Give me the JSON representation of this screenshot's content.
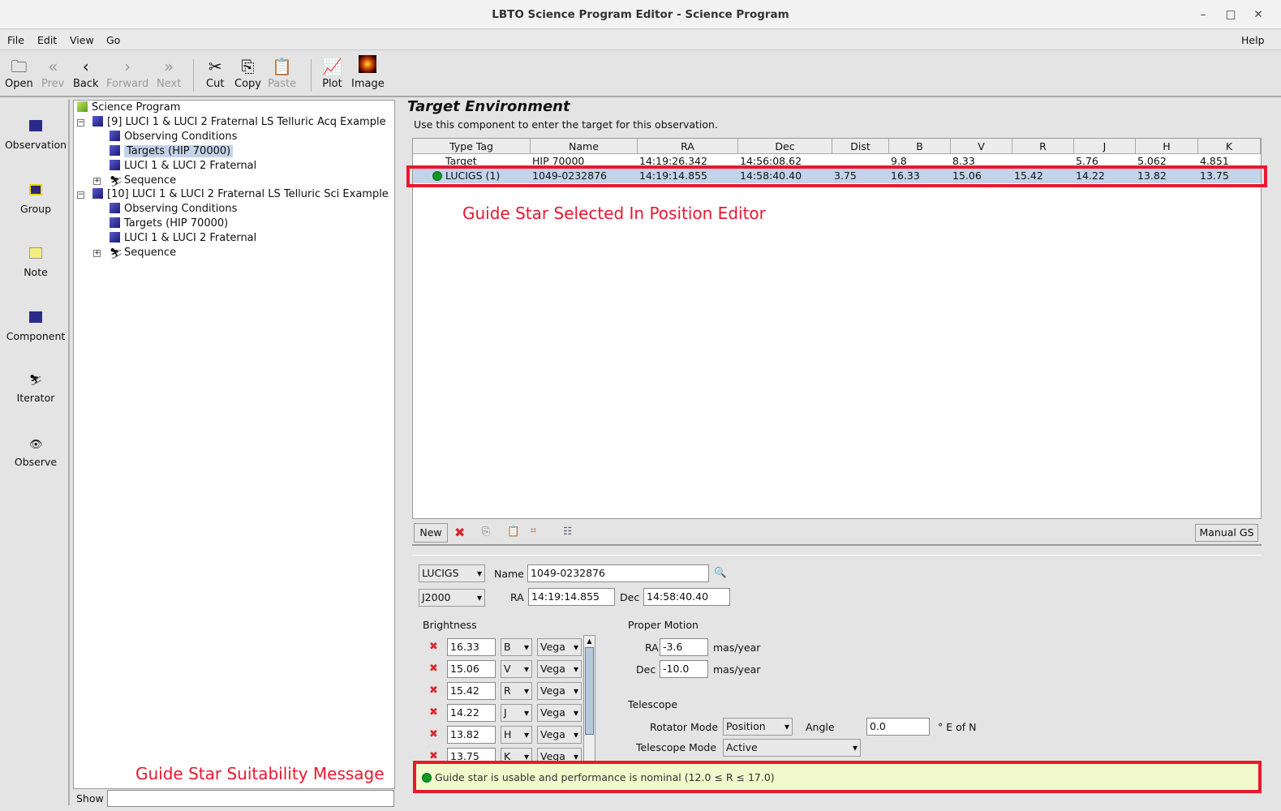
{
  "window": {
    "title": "LBTO Science Program Editor - Science Program",
    "minimize": "–",
    "maximize": "□",
    "close": "✕"
  },
  "menu": {
    "file": "File",
    "edit": "Edit",
    "view": "View",
    "go": "Go",
    "help": "Help"
  },
  "toolbar": {
    "open": "Open",
    "prev": "Prev",
    "back": "Back",
    "forward": "Forward",
    "next": "Next",
    "cut": "Cut",
    "copy": "Copy",
    "paste": "Paste",
    "plot": "Plot",
    "image": "Image"
  },
  "palette": {
    "observation": "Observation",
    "group": "Group",
    "note": "Note",
    "component": "Component",
    "iterator": "Iterator",
    "observe": "Observe"
  },
  "tree": {
    "root": "Science Program",
    "obs1": {
      "label": "[9] LUCI 1 & LUCI 2 Fraternal LS Telluric Acq Example",
      "children": [
        "Observing Conditions",
        "Targets (HIP 70000)",
        "LUCI 1 & LUCI 2 Fraternal",
        "Sequence"
      ]
    },
    "obs2": {
      "label": "[10] LUCI 1 & LUCI 2 Fraternal LS Telluric Sci Example",
      "children": [
        "Observing Conditions",
        "Targets (HIP 70000)",
        "LUCI 1 & LUCI 2 Fraternal",
        "Sequence"
      ]
    },
    "show_label": "Show"
  },
  "panel": {
    "title": "Target Environment",
    "description": "Use this component to enter the target for this observation."
  },
  "table": {
    "columns": [
      "Type Tag",
      "Name",
      "RA",
      "Dec",
      "Dist",
      "B",
      "V",
      "R",
      "J",
      "H",
      "K"
    ],
    "rows": [
      [
        "Target",
        "HIP 70000",
        "14:19:26.342",
        "14:56:08.62",
        "",
        "9.8",
        "8.33",
        "",
        "5.76",
        "5.062",
        "4.851"
      ],
      [
        "LUCIGS (1)",
        "1049-0232876",
        "14:19:14.855",
        "14:58:40.40",
        "3.75",
        "16.33",
        "15.06",
        "15.42",
        "14.22",
        "13.82",
        "13.75"
      ]
    ]
  },
  "table_toolbar": {
    "new": "New",
    "manual_gs": "Manual GS"
  },
  "annotations": {
    "guide_star_selected": "Guide Star Selected In Position Editor",
    "suitability": "Guide Star Suitability Message"
  },
  "editor": {
    "tag": "LUCIGS",
    "name_label": "Name",
    "name": "1049-0232876",
    "system": "J2000",
    "ra_label": "RA",
    "ra": "14:19:14.855",
    "dec_label": "Dec",
    "dec": "14:58:40.40",
    "brightness_label": "Brightness",
    "brightness": [
      {
        "value": "16.33",
        "band": "B",
        "system": "Vega"
      },
      {
        "value": "15.06",
        "band": "V",
        "system": "Vega"
      },
      {
        "value": "15.42",
        "band": "R",
        "system": "Vega"
      },
      {
        "value": "14.22",
        "band": "J",
        "system": "Vega"
      },
      {
        "value": "13.82",
        "band": "H",
        "system": "Vega"
      },
      {
        "value": "13.75",
        "band": "K",
        "system": "Vega"
      }
    ],
    "pm_label": "Proper Motion",
    "pm_ra_label": "RA",
    "pm_ra": "-3.6",
    "pm_dec_label": "Dec",
    "pm_dec": "-10.0",
    "pm_unit": "mas/year",
    "telescope_label": "Telescope",
    "rotator_label": "Rotator Mode",
    "rotator": "Position",
    "angle_label": "Angle",
    "angle": "0.0",
    "angle_unit": "° E of N",
    "tmode_label": "Telescope Mode",
    "tmode": "Active"
  },
  "status": {
    "message": "Guide star is usable and performance is nominal (12.0 ≤ R ≤ 17.0)",
    "color": "#139a13"
  }
}
